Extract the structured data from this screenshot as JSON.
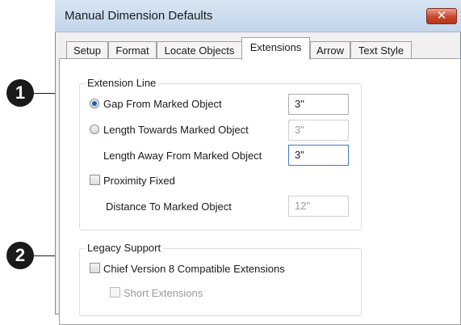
{
  "window": {
    "title": "Manual Dimension Defaults",
    "close_label": "✕"
  },
  "tabs": [
    {
      "label": "Setup",
      "active": false
    },
    {
      "label": "Format",
      "active": false
    },
    {
      "label": "Locate Objects",
      "active": false
    },
    {
      "label": "Extensions",
      "active": true
    },
    {
      "label": "Arrow",
      "active": false
    },
    {
      "label": "Text Style",
      "active": false
    }
  ],
  "extension_line": {
    "legend": "Extension Line",
    "gap_label": "Gap From Marked Object",
    "gap_value": "3\"",
    "length_towards_label": "Length Towards Marked Object",
    "length_towards_value": "3\"",
    "length_away_label": "Length Away From Marked Object",
    "length_away_value": "3\"",
    "proximity_label": "Proximity Fixed",
    "distance_label": "Distance To Marked Object",
    "distance_value": "12\""
  },
  "legacy_support": {
    "legend": "Legacy Support",
    "chief_label": "Chief Version 8 Compatible Extensions",
    "short_label": "Short Extensions"
  },
  "callouts": [
    "1",
    "2"
  ]
}
